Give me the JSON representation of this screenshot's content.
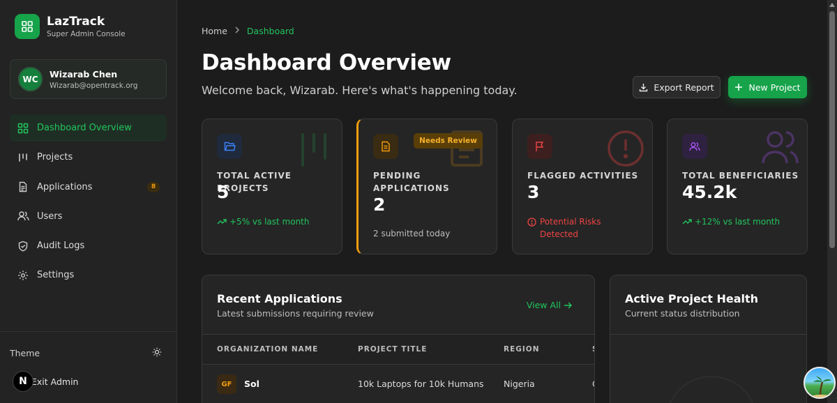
{
  "brand": {
    "name": "LazTrack",
    "subtitle": "Super Admin Console"
  },
  "user": {
    "initials": "WC",
    "name": "Wizarab Chen",
    "email": "Wizarab@opentrack.org"
  },
  "nav": [
    {
      "label": "Dashboard Overview",
      "icon": "dashboard-grid-icon",
      "active": true
    },
    {
      "label": "Projects",
      "icon": "projects-bars-icon"
    },
    {
      "label": "Applications",
      "icon": "document-icon",
      "badge": "8"
    },
    {
      "label": "Users",
      "icon": "users-icon"
    },
    {
      "label": "Audit Logs",
      "icon": "shield-icon"
    },
    {
      "label": "Settings",
      "icon": "gear-icon"
    }
  ],
  "footer": {
    "theme_label": "Theme",
    "exit_label": "Exit Admin",
    "n_badge": "N"
  },
  "breadcrumb": {
    "home": "Home",
    "current": "Dashboard"
  },
  "header": {
    "title": "Dashboard Overview",
    "subtitle": "Welcome back, Wizarab. Here's what's happening today.",
    "export_label": "Export Report",
    "new_project_label": "New Project"
  },
  "stats": [
    {
      "label": "TOTAL ACTIVE PROJECTS",
      "value": "5",
      "note": "+5% vs last month",
      "note_color": "#22c55e",
      "icon": "folder-icon",
      "accent": "#3b82f6"
    },
    {
      "label": "PENDING APPLICATIONS",
      "value": "2",
      "note": "2 submitted today",
      "note_color": "#bdbdbd",
      "icon": "document-icon",
      "accent": "#f59e0b",
      "pill": "Needs Review"
    },
    {
      "label": "FLAGGED ACTIVITIES",
      "value": "3",
      "note": "Potential Risks Detected",
      "note_color": "#ef4444",
      "icon": "flag-icon",
      "accent": "#ef4444"
    },
    {
      "label": "TOTAL BENEFICIARIES",
      "value": "45.2k",
      "note": "+12% vs last month",
      "note_color": "#22c55e",
      "icon": "users-icon",
      "accent": "#a855f7"
    }
  ],
  "recent": {
    "title": "Recent Applications",
    "subtitle": "Latest submissions requiring review",
    "view_all": "View All",
    "columns": [
      "ORGANIZATION NAME",
      "PROJECT TITLE",
      "REGION",
      "S"
    ],
    "rows": [
      {
        "initials": "GF",
        "org": "Sol",
        "project": "10k Laptops for 10k Humans",
        "region": "Nigeria",
        "status": "C"
      }
    ]
  },
  "health": {
    "title": "Active Project Health",
    "subtitle": "Current status distribution"
  },
  "colors": {
    "accent": "#16a34a",
    "bg": "#1c1c1c",
    "card": "#252525"
  }
}
